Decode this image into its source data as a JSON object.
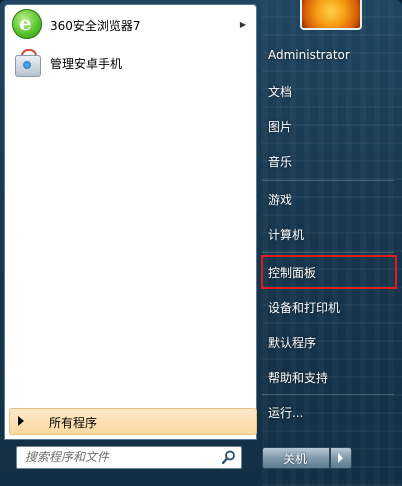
{
  "pinned_programs": [
    {
      "label": "360安全浏览器7",
      "icon": "browser-360-icon",
      "has_submenu": true
    },
    {
      "label": "管理安卓手机",
      "icon": "android-manager-icon",
      "has_submenu": false
    }
  ],
  "all_programs": {
    "label": "所有程序"
  },
  "search": {
    "placeholder": "搜索程序和文件"
  },
  "right_panel": {
    "user": "Administrator",
    "items": [
      "文档",
      "图片",
      "音乐",
      "游戏",
      "计算机",
      "控制面板",
      "设备和打印机",
      "默认程序",
      "帮助和支持",
      "运行..."
    ]
  },
  "highlighted_item": "控制面板",
  "highlight_color": "#e01d1d",
  "shutdown": {
    "label": "关机"
  }
}
